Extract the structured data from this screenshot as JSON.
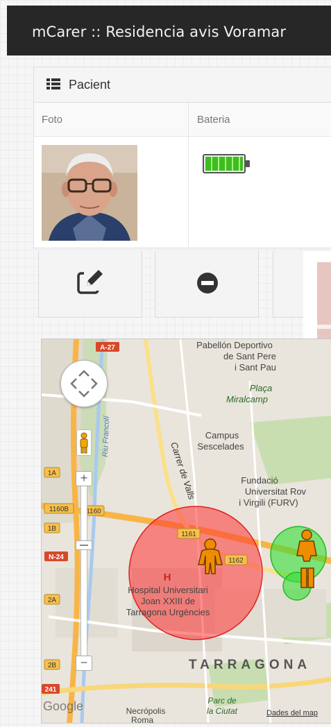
{
  "header": {
    "title": "mCarer :: Residencia avis Voramar"
  },
  "panel": {
    "title": "Pacient",
    "columns": [
      "Foto",
      "Bateria"
    ],
    "battery_level": 1.0
  },
  "actions": [
    {
      "name": "edit-button",
      "icon": "edit-icon"
    },
    {
      "name": "remove-button",
      "icon": "minus-circle-icon"
    }
  ],
  "map": {
    "zoom_plus": "+",
    "zoom_minus": "−",
    "labels": {
      "a27": "A-27",
      "pabellon": "Pabellón Deportivo",
      "sant_pere": "de Sant Pere",
      "sant_pau": "i Sant Pau",
      "placa": "Plaça",
      "miralcamp": "Miralcamp",
      "campus": "Campus",
      "sescelades": "Sescelades",
      "riu": "Riu Francolí",
      "carrer": "Carrer de Valls",
      "fundacio": "Fundació",
      "universitat": "Universitat Rov",
      "virgili": "i Virgili (FURV)",
      "r1a": "1A",
      "r1160b": "1160B",
      "r1160": "1160",
      "r1b": "1B",
      "r1161": "1161",
      "r1162": "1162",
      "n24": "N-24",
      "r2a": "2A",
      "r2b": "2B",
      "r241": "241",
      "hosp_h": "H",
      "hosp1": "Hospital Universitari",
      "hosp2": "Joan XXIII de",
      "hosp3": "Tarragona Urgències",
      "tarragona": "TARRAGONA",
      "parc1": "Parc de",
      "parc2": "la Ciutat",
      "necropolis": "Necrópolis",
      "roma": "Roma",
      "google": "Google",
      "dades": "Dades del map"
    }
  },
  "colors": {
    "topbar": "#272727",
    "circle_red": "#ff3333",
    "circle_green": "#33dd33",
    "person_marker": "#f08c00"
  }
}
